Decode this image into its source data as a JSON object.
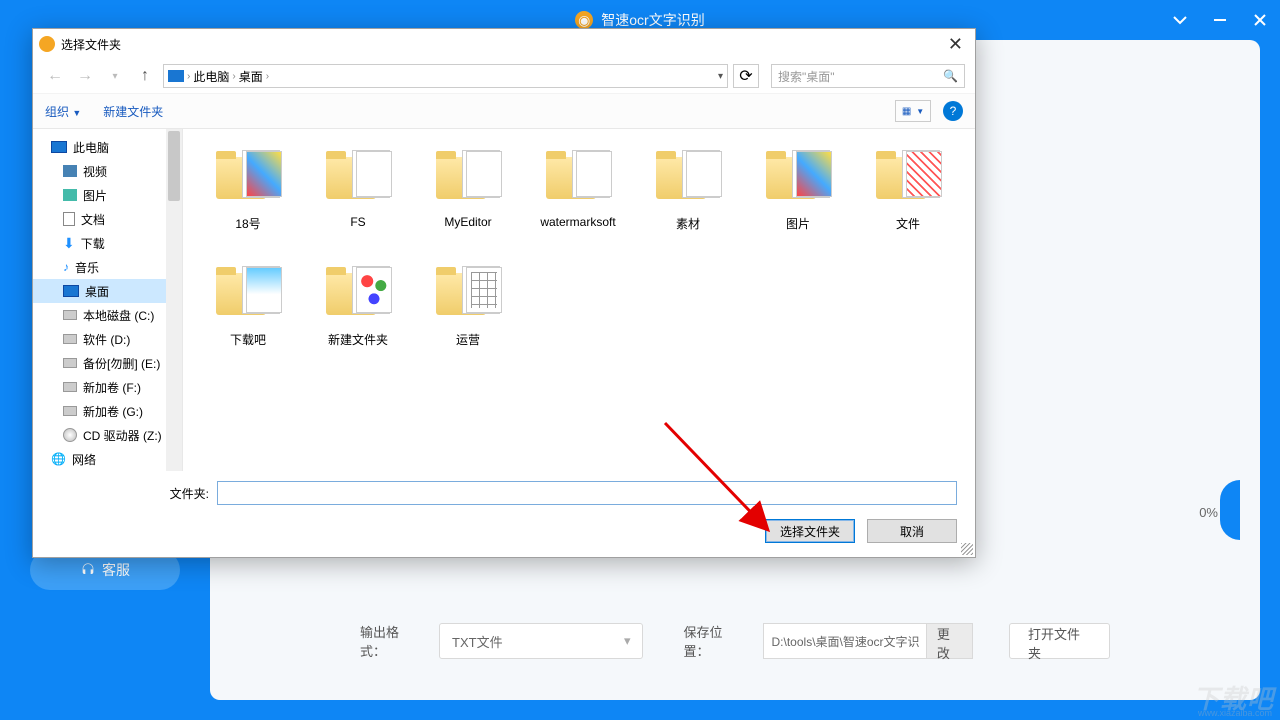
{
  "app": {
    "title": "智速ocr文字识别",
    "sidebar_customer_service": "客服",
    "output_format_label": "输出格式：",
    "output_format_value": "TXT文件",
    "save_location_label": "保存位置：",
    "save_location_value": "D:\\tools\\桌面\\智速ocr文字识",
    "change_btn": "更改",
    "open_folder_btn": "打开文件夹",
    "progress": "0%"
  },
  "dialog": {
    "title": "选择文件夹",
    "breadcrumb": {
      "root": "此电脑",
      "loc": "桌面"
    },
    "search_placeholder": "搜索\"桌面\"",
    "toolbar": {
      "organize": "组织",
      "new_folder": "新建文件夹"
    },
    "tree": [
      {
        "label": "此电脑",
        "icon": "monitor",
        "indent": 0
      },
      {
        "label": "视频",
        "icon": "video",
        "indent": 1
      },
      {
        "label": "图片",
        "icon": "pic",
        "indent": 1
      },
      {
        "label": "文档",
        "icon": "doc",
        "indent": 1
      },
      {
        "label": "下载",
        "icon": "dl",
        "indent": 1
      },
      {
        "label": "音乐",
        "icon": "music",
        "indent": 1
      },
      {
        "label": "桌面",
        "icon": "monitor",
        "indent": 1,
        "selected": true
      },
      {
        "label": "本地磁盘 (C:)",
        "icon": "drive",
        "indent": 1
      },
      {
        "label": "软件 (D:)",
        "icon": "drive",
        "indent": 1
      },
      {
        "label": "备份[勿删] (E:)",
        "icon": "drive",
        "indent": 1
      },
      {
        "label": "新加卷 (F:)",
        "icon": "drive",
        "indent": 1
      },
      {
        "label": "新加卷 (G:)",
        "icon": "drive",
        "indent": 1
      },
      {
        "label": "CD 驱动器 (Z:)",
        "icon": "cd",
        "indent": 1
      },
      {
        "label": "网络",
        "icon": "net",
        "indent": 0
      }
    ],
    "folders": [
      {
        "name": "18号",
        "thumb": "colorful"
      },
      {
        "name": "FS",
        "thumb": ""
      },
      {
        "name": "MyEditor",
        "thumb": ""
      },
      {
        "name": "watermarksoft",
        "thumb": ""
      },
      {
        "name": "素材",
        "thumb": ""
      },
      {
        "name": "图片",
        "thumb": "colorful"
      },
      {
        "name": "文件",
        "thumb": "red"
      },
      {
        "name": "下载吧",
        "thumb": "blue"
      },
      {
        "name": "新建文件夹",
        "thumb": "dots"
      },
      {
        "name": "运营",
        "thumb": "grid"
      }
    ],
    "file_label": "文件夹:",
    "file_value": "",
    "btn_select": "选择文件夹",
    "btn_cancel": "取消"
  },
  "watermark": "下载吧"
}
